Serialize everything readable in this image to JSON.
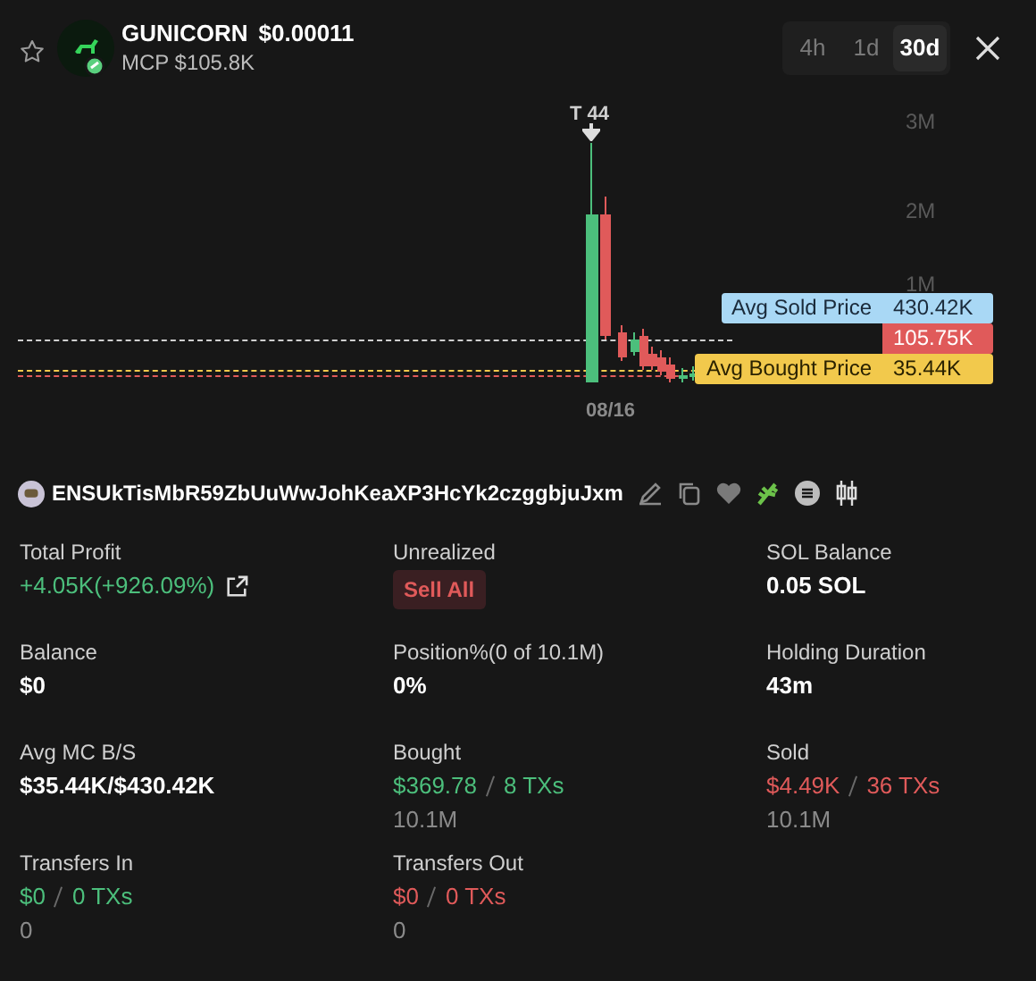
{
  "token": {
    "name": "GUNICORN",
    "price": "$0.00011",
    "mcp": "MCP $105.8K",
    "favorite": false
  },
  "ranges": [
    {
      "label": "4h",
      "selected": false
    },
    {
      "label": "1d",
      "selected": false
    },
    {
      "label": "30d",
      "selected": true
    }
  ],
  "chart": {
    "marker": "T 44",
    "y_labels": [
      "3M",
      "2M",
      "1M"
    ],
    "x_label": "08/16",
    "price_tags": [
      {
        "kind": "sold",
        "label": "Avg Sold Price",
        "value": "430.42K"
      },
      {
        "kind": "current",
        "value": "105.75K"
      },
      {
        "kind": "bought",
        "label": "Avg Bought Price",
        "value": "35.44K"
      }
    ]
  },
  "wallet": {
    "address": "ENSUkTisMbR59ZbUuWwJohKeaXP3HcYk2czggbjuJxm"
  },
  "stats": [
    {
      "kind": "profit",
      "label": "Total Profit",
      "value": "+4.05K(+926.09%)",
      "color": "#4cbf7c"
    },
    {
      "kind": "button",
      "label": "Unrealized",
      "button": "Sell All"
    },
    {
      "kind": "text",
      "label": "SOL Balance",
      "value": "0.05 SOL"
    },
    {
      "kind": "text",
      "label": "Balance",
      "value": "$0"
    },
    {
      "kind": "text",
      "label": "Position%(0 of 10.1M)",
      "value": "0%"
    },
    {
      "kind": "text",
      "label": "Holding Duration",
      "value": "43m"
    },
    {
      "kind": "text",
      "label": "Avg MC B/S",
      "value": "$35.44K/$430.42K"
    },
    {
      "kind": "pair",
      "label": "Bought",
      "amount": "$369.78",
      "txs": "8 TXs",
      "sub": "10.1M",
      "color": "#4cbf7c"
    },
    {
      "kind": "pair",
      "label": "Sold",
      "amount": "$4.49K",
      "txs": "36 TXs",
      "sub": "10.1M",
      "color": "#e05a5a"
    },
    {
      "kind": "pair",
      "label": "Transfers In",
      "amount": "$0",
      "txs": "0 TXs",
      "sub": "0",
      "color": "#4cbf7c"
    },
    {
      "kind": "pair",
      "label": "Transfers Out",
      "amount": "$0",
      "txs": "0 TXs",
      "sub": "0",
      "color": "#e05a5a"
    }
  ]
}
